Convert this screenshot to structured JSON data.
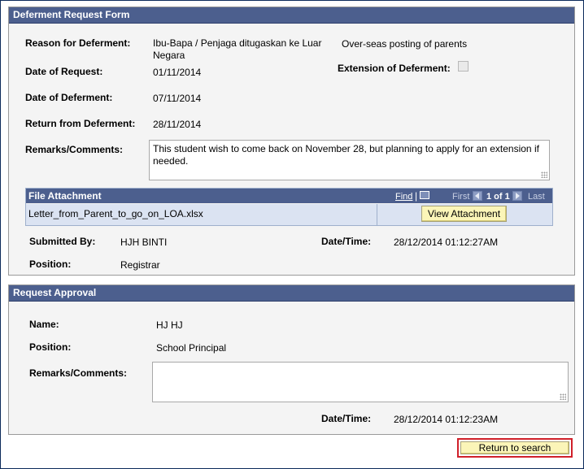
{
  "deferment_form": {
    "header": "Deferment Request Form",
    "reason_label": "Reason for Deferment:",
    "reason_value_line1": "Ibu-Bapa / Penjaga ditugaskan ke Luar",
    "reason_value_line2": "Negara",
    "reason_description": "Over-seas posting of parents",
    "date_of_request_label": "Date of Request:",
    "date_of_request_value": "01/11/2014",
    "extension_label": "Extension of Deferment:",
    "extension_checked": false,
    "date_of_deferment_label": "Date of Deferment:",
    "date_of_deferment_value": "07/11/2014",
    "return_label": "Return from Deferment:",
    "return_value": "28/11/2014",
    "remarks_label": "Remarks/Comments:",
    "remarks_value": "This student wish to come back on November 28, but planning to apply for an extension if needed.",
    "file_attachment": {
      "header": "File Attachment",
      "find_link": "Find",
      "first_label": "First",
      "pager_text": "1 of 1",
      "last_label": "Last",
      "file_name": "Letter_from_Parent_to_go_on_LOA.xlsx",
      "view_button": "View Attachment"
    },
    "submitted_by_label": "Submitted By:",
    "submitted_by_value": "HJH BINTI",
    "datetime_label": "Date/Time:",
    "datetime_value": "28/12/2014 01:12:27AM",
    "position_label": "Position:",
    "position_value": "Registrar"
  },
  "request_approval": {
    "header": "Request Approval",
    "name_label": "Name:",
    "name_value": "HJ HJ",
    "position_label": "Position:",
    "position_value": "School Principal",
    "remarks_label": "Remarks/Comments:",
    "remarks_value": "",
    "datetime_label": "Date/Time:",
    "datetime_value": "28/12/2014 01:12:23AM"
  },
  "return_button": "Return to search",
  "colors": {
    "header_bg": "#4c5f8e",
    "section_bg": "#f4f4f4",
    "button_bg": "#fbf5b8",
    "highlight_border": "#d0202a",
    "grid_row_bg": "#dbe3f2"
  }
}
